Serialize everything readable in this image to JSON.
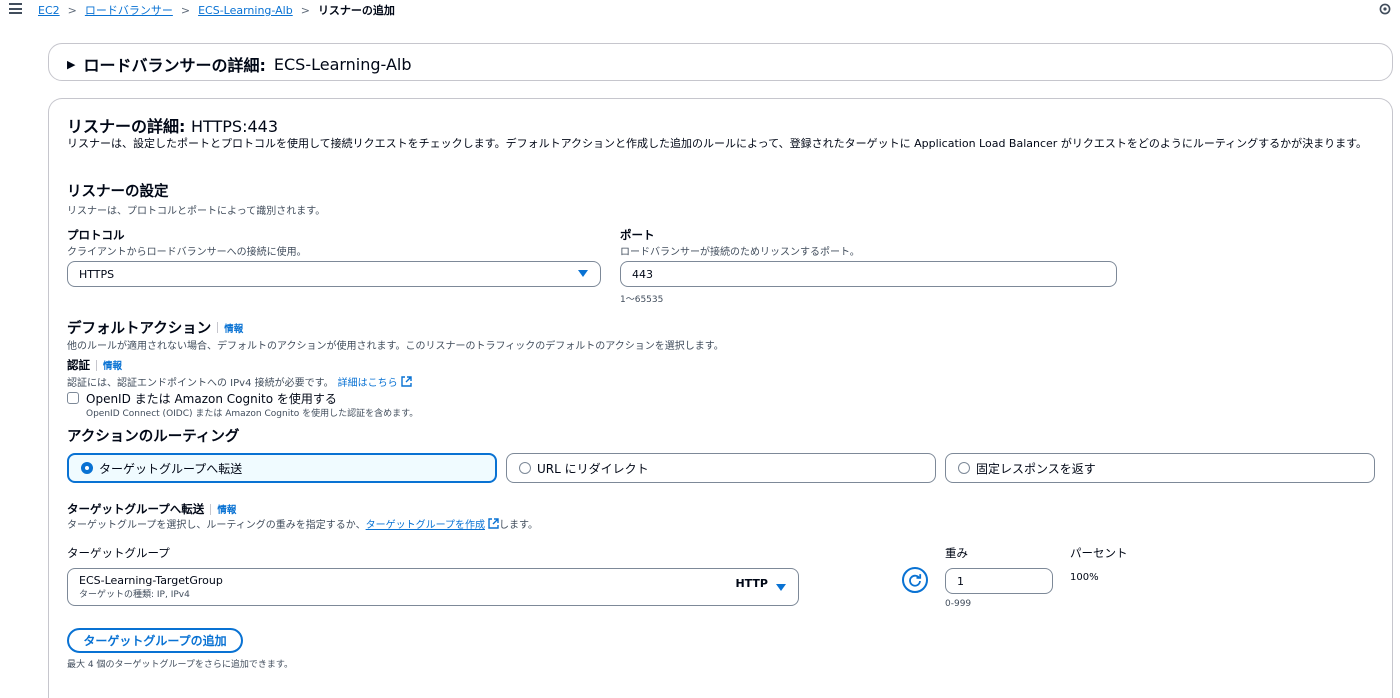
{
  "breadcrumb": {
    "items": [
      "EC2",
      "ロードバランサー",
      "ECS-Learning-Alb"
    ],
    "current": "リスナーの追加",
    "separator": ">"
  },
  "lb_details": {
    "title": "ロードバランサーの詳細:",
    "name": "ECS-Learning-Alb",
    "caret": "▶"
  },
  "listener": {
    "title": "リスナーの詳細:",
    "value": "HTTPS:443",
    "description": "リスナーは、設定したポートとプロトコルを使用して接続リクエストをチェックします。デフォルトアクションと作成した追加のルールによって、登録されたターゲットに Application Load Balancer がリクエストをどのようにルーティングするかが決まります。"
  },
  "config": {
    "title": "リスナーの設定",
    "description": "リスナーは、プロトコルとポートによって識別されます。",
    "protocol_label": "プロトコル",
    "protocol_desc": "クライアントからロードバランサーへの接続に使用。",
    "protocol_value": "HTTPS",
    "port_label": "ポート",
    "port_desc": "ロードバランサーが接続のためリッスンするポート。",
    "port_value": "443",
    "port_hint": "1〜65535"
  },
  "default_action": {
    "title": "デフォルトアクション",
    "info": "情報",
    "description": "他のルールが適用されない場合、デフォルトのアクションが使用されます。このリスナーのトラフィックのデフォルトのアクションを選択します。"
  },
  "auth": {
    "title": "認証",
    "info": "情報",
    "description": "認証には、認証エンドポイントへの IPv4 接続が必要です。",
    "learn_more": "詳細はこちら",
    "checkbox_label": "OpenID または Amazon Cognito を使用する",
    "checkbox_desc": "OpenID Connect (OIDC) または Amazon Cognito を使用した認証を含めます。",
    "checked": false
  },
  "routing": {
    "title": "アクションのルーティング",
    "options": [
      {
        "label": "ターゲットグループへ転送",
        "selected": true
      },
      {
        "label": "URL にリダイレクト",
        "selected": false
      },
      {
        "label": "固定レスポンスを返す",
        "selected": false
      }
    ]
  },
  "forward": {
    "title": "ターゲットグループへ転送",
    "info": "情報",
    "desc_prefix": "ターゲットグループを選択し、ルーティングの重みを指定するか、",
    "create_link": "ターゲットグループを作成",
    "desc_suffix": "します。",
    "tg_label": "ターゲットグループ",
    "tg_name": "ECS-Learning-TargetGroup",
    "tg_type": "ターゲットの種類: IP, IPv4",
    "tg_protocol": "HTTP",
    "weight_label": "重み",
    "weight_value": "1",
    "weight_hint": "0-999",
    "percent_label": "パーセント",
    "percent_value": "100%",
    "add_button": "ターゲットグループの追加",
    "add_hint": "最大 4 個のターゲットグループをさらに追加できます。"
  },
  "colors": {
    "accent": "#0972d3",
    "border": "#7d8998",
    "text": "#000716"
  }
}
